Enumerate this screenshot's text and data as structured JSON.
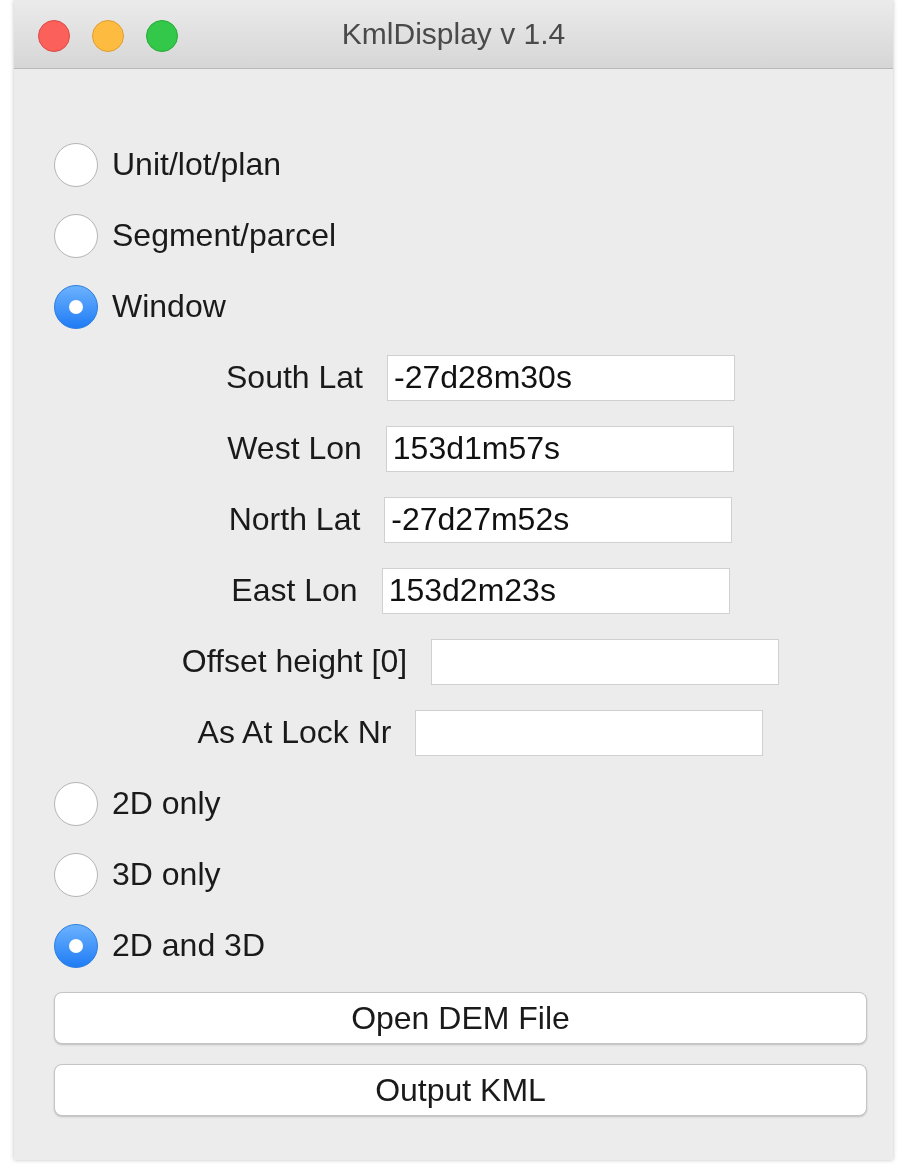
{
  "window": {
    "title": "KmlDisplay v 1.4"
  },
  "modes": [
    {
      "label": "Unit/lot/plan",
      "selected": false
    },
    {
      "label": "Segment/parcel",
      "selected": false
    },
    {
      "label": "Window",
      "selected": true
    }
  ],
  "fields": [
    {
      "label": "South Lat",
      "value": "-27d28m30s"
    },
    {
      "label": "West Lon",
      "value": "153d1m57s"
    },
    {
      "label": "North Lat",
      "value": "-27d27m52s"
    },
    {
      "label": "East Lon",
      "value": "153d2m23s"
    },
    {
      "label": "Offset height [0]"
    },
    {
      "label": "As At Lock Nr"
    }
  ],
  "outputs": [
    {
      "label": "2D only",
      "selected": false
    },
    {
      "label": "3D only",
      "selected": false
    },
    {
      "label": "2D and 3D",
      "selected": true
    }
  ],
  "buttons": [
    "Open DEM File",
    "Output KML"
  ]
}
